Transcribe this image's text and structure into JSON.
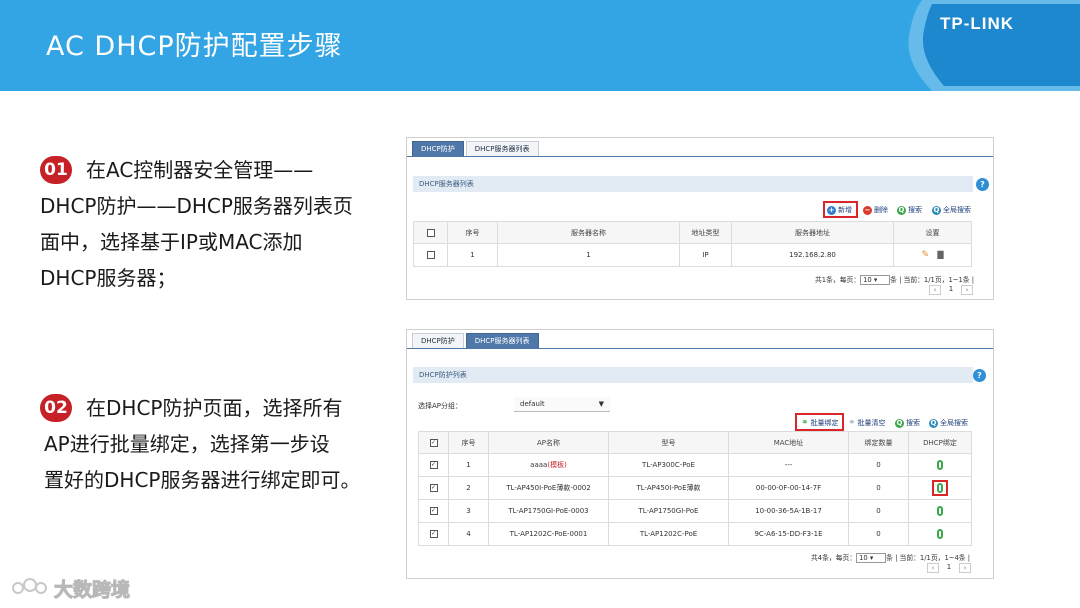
{
  "header": {
    "title": "AC DHCP防护配置步骤",
    "logo": "TP-LINK"
  },
  "colors": {
    "header_bg": "#33a4e4",
    "step_badge": "#c52127",
    "highlight_box": "#d9262b"
  },
  "steps": [
    {
      "num": "01",
      "lines": [
        "在AC控制器安全管理——",
        "DHCP防护——DHCP服务器列表页",
        "面中，选择基于IP或MAC添加",
        "DHCP服务器；"
      ]
    },
    {
      "num": "02",
      "lines": [
        "在DHCP防护页面，选择所有",
        "AP进行批量绑定，选择第一步设",
        "置好的DHCP服务器进行绑定即可。"
      ]
    }
  ],
  "watermark": "大数跨境",
  "shot1": {
    "tabs": [
      "DHCP防护",
      "DHCP服务器列表"
    ],
    "section": "DHCP服务器列表",
    "help": "?",
    "actions": {
      "add": "新增",
      "delete": "删除",
      "search": "搜索",
      "global_search": "全局搜索"
    },
    "columns": [
      "",
      "序号",
      "服务器名称",
      "地址类型",
      "服务器地址",
      "设置"
    ],
    "rows": [
      {
        "idx": "1",
        "name": "1",
        "type": "IP",
        "addr": "192.168.2.80"
      }
    ],
    "pager": {
      "prefix": "共1条，每页：",
      "per_page": "10",
      "suffix": "条 | 当前：1/1页，1~1条 |",
      "page": "1"
    }
  },
  "shot2": {
    "tabs": [
      "DHCP防护",
      "DHCP服务器列表"
    ],
    "section": "DHCP防护列表",
    "help": "?",
    "group_label": "选择AP分组：",
    "group_value": "default",
    "actions": {
      "bind": "批量绑定",
      "clear": "批量清空",
      "search": "搜索",
      "global_search": "全局搜索"
    },
    "columns": [
      "",
      "序号",
      "AP名称",
      "型号",
      "MAC地址",
      "绑定数量",
      "DHCP绑定"
    ],
    "rows": [
      {
        "idx": "1",
        "name": "aaaa",
        "tag": "(模板)",
        "model": "TL-AP300C-PoE",
        "mac": "---",
        "count": "0"
      },
      {
        "idx": "2",
        "name": "TL-AP450I-PoE薄款-0002",
        "tag": "",
        "model": "TL-AP450I-PoE薄款",
        "mac": "00-00-0F-00-14-7F",
        "count": "0"
      },
      {
        "idx": "3",
        "name": "TL-AP1750GI-PoE-0003",
        "tag": "",
        "model": "TL-AP1750GI-PoE",
        "mac": "10-00-36-5A-1B-17",
        "count": "0"
      },
      {
        "idx": "4",
        "name": "TL-AP1202C-PoE-0001",
        "tag": "",
        "model": "TL-AP1202C-PoE",
        "mac": "9C-A6-15-DD-F3-1E",
        "count": "0"
      }
    ],
    "pager": {
      "prefix": "共4条，每页：",
      "per_page": "10",
      "suffix": "条 | 当前：1/1页，1~4条 |",
      "page": "1"
    }
  }
}
